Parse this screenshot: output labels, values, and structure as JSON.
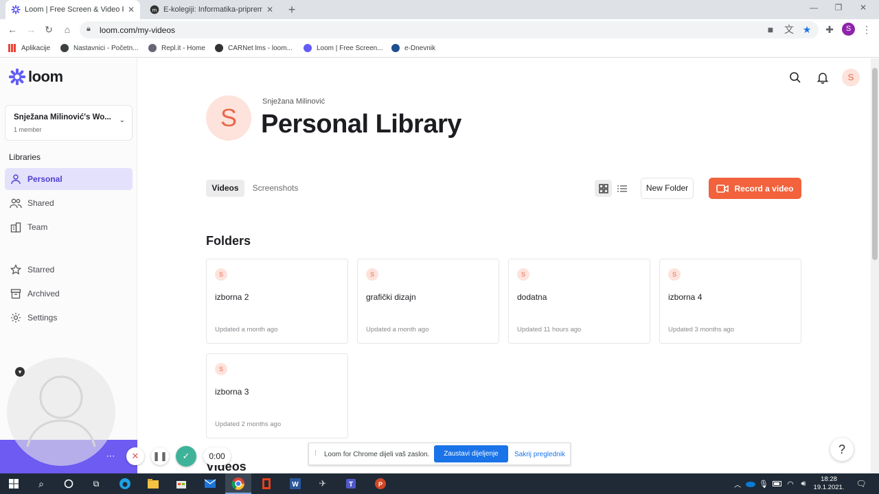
{
  "browser": {
    "tabs": [
      {
        "title": "Loom | Free Screen & Video Reco",
        "active": true
      },
      {
        "title": "E-kolegiji: Informatika-priprema z",
        "active": false
      }
    ],
    "url": "loom.com/my-videos",
    "bookmarks": [
      "Aplikacije",
      "Nastavnici - Početn...",
      "Repl.it - Home",
      "CARNet lms - loom...",
      "Loom | Free Screen...",
      "e-Dnevnik"
    ]
  },
  "colors": {
    "brand": "#625df5",
    "record": "#f2623c",
    "selected_bg": "#e3e1fb",
    "avatar_bg": "#fde3dc",
    "avatar_fg": "#e8694a"
  },
  "sidebar": {
    "logo": "loom",
    "workspace": {
      "name": "Snježana Milinović's Wo...",
      "meta": "1 member"
    },
    "libraries_heading": "Libraries",
    "items": [
      {
        "label": "Personal",
        "icon": "person-icon",
        "selected": true
      },
      {
        "label": "Shared",
        "icon": "people-icon"
      },
      {
        "label": "Team",
        "icon": "building-icon"
      },
      {
        "label": "Starred",
        "icon": "star-icon"
      },
      {
        "label": "Archived",
        "icon": "archive-icon"
      },
      {
        "label": "Settings",
        "icon": "gear-icon"
      }
    ]
  },
  "header": {
    "user_initial": "S"
  },
  "main": {
    "avatar_initial": "S",
    "owner": "Snježana Milinović",
    "title": "Personal Library",
    "tabs": [
      "Videos",
      "Screenshots"
    ],
    "new_folder": "New Folder",
    "record": "Record a video",
    "folders_heading": "Folders",
    "folders": [
      {
        "name": "izborna 2",
        "updated": "Updated a month ago"
      },
      {
        "name": "grafički dizajn",
        "updated": "Updated a month ago"
      },
      {
        "name": "dodatna",
        "updated": "Updated 11 hours ago"
      },
      {
        "name": "izborna 4",
        "updated": "Updated 3 months ago"
      },
      {
        "name": "izborna 3",
        "updated": "Updated 2 months ago"
      }
    ],
    "folder_initial": "S",
    "videos_heading": "Videos"
  },
  "sharing_bar": {
    "text": "Loom for Chrome dijeli vaš zaslon.",
    "stop": "Zaustavi dijeljenje",
    "hide": "Sakrij preglednik"
  },
  "recorder": {
    "timer": "0:00"
  },
  "help": "?",
  "taskbar": {
    "time": "18:28",
    "date": "19.1.2021."
  }
}
